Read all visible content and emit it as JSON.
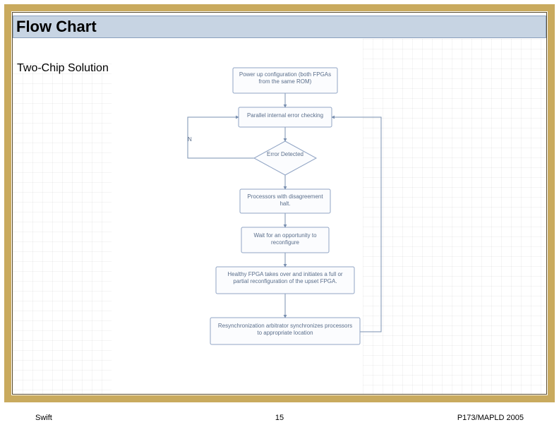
{
  "title": "Flow Chart",
  "subtitle": "Two-Chip Solution",
  "flow": {
    "nodes": {
      "powerup": "Power up configuration (both FPGAs from the same ROM)",
      "parallel": "Parallel internal error checking",
      "error": "Error Detected",
      "halt": "Processors with disagreement halt.",
      "wait": "Wait for an opportunity to reconfigure",
      "takeover": "Healthy FPGA takes over and initiates a full or partial reconfiguration of the upset FPGA.",
      "resync": "Resynchronization arbitrator synchronizes processors to appropriate location"
    },
    "edges": {
      "no_label": "N"
    }
  },
  "footer": {
    "left": "Swift",
    "center": "15",
    "right": "P173/MAPLD 2005"
  }
}
